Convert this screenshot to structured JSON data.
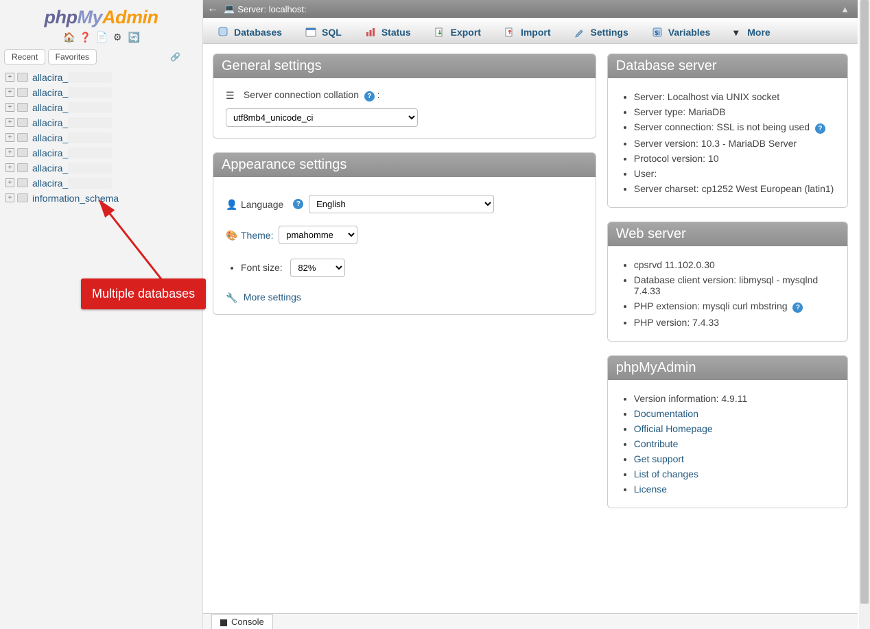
{
  "logo": {
    "p1": "php",
    "p2": "My",
    "p3": "Admin"
  },
  "sidebar_icons": [
    "🏠",
    "❓",
    "📄",
    "⚙",
    "🔄"
  ],
  "sidebar_tabs": {
    "recent": "Recent",
    "favorites": "Favorites"
  },
  "databases": [
    "allacira_",
    "allacira_",
    "allacira_",
    "allacira_",
    "allacira_",
    "allacira_",
    "allacira_",
    "allacira_",
    "information_schema"
  ],
  "annotation": "Multiple databases",
  "breadcrumb": {
    "label": "Server:",
    "value": "localhost:"
  },
  "topnav": [
    {
      "label": "Databases",
      "icon": "db"
    },
    {
      "label": "SQL",
      "icon": "sql"
    },
    {
      "label": "Status",
      "icon": "status"
    },
    {
      "label": "Export",
      "icon": "export"
    },
    {
      "label": "Import",
      "icon": "import"
    },
    {
      "label": "Settings",
      "icon": "settings"
    },
    {
      "label": "Variables",
      "icon": "vars"
    },
    {
      "label": "More",
      "icon": "more"
    }
  ],
  "general": {
    "heading": "General settings",
    "collation_label": "Server connection collation",
    "collation_value": "utf8mb4_unicode_ci"
  },
  "appearance": {
    "heading": "Appearance settings",
    "language_label": "Language",
    "language_value": "English",
    "theme_label": "Theme:",
    "theme_value": "pmahomme",
    "fontsize_label": "Font size:",
    "fontsize_value": "82%",
    "more_settings": "More settings"
  },
  "dbserver": {
    "heading": "Database server",
    "items": [
      "Server: Localhost via UNIX socket",
      "Server type: MariaDB",
      "Server connection: SSL is not being used",
      "Server version: 10.3             - MariaDB Server",
      "Protocol version: 10",
      "User:",
      "Server charset: cp1252 West European (latin1)"
    ]
  },
  "webserver": {
    "heading": "Web server",
    "items": [
      "cpsrvd 11.102.0.30",
      "Database client version: libmysql - mysqlnd 7.4.33",
      "PHP extension: mysqli curl mbstring",
      "PHP version: 7.4.33"
    ]
  },
  "pma": {
    "heading": "phpMyAdmin",
    "version": "Version information: 4.9.11",
    "links": [
      "Documentation",
      "Official Homepage",
      "Contribute",
      "Get support",
      "List of changes",
      "License"
    ]
  },
  "console": "Console"
}
